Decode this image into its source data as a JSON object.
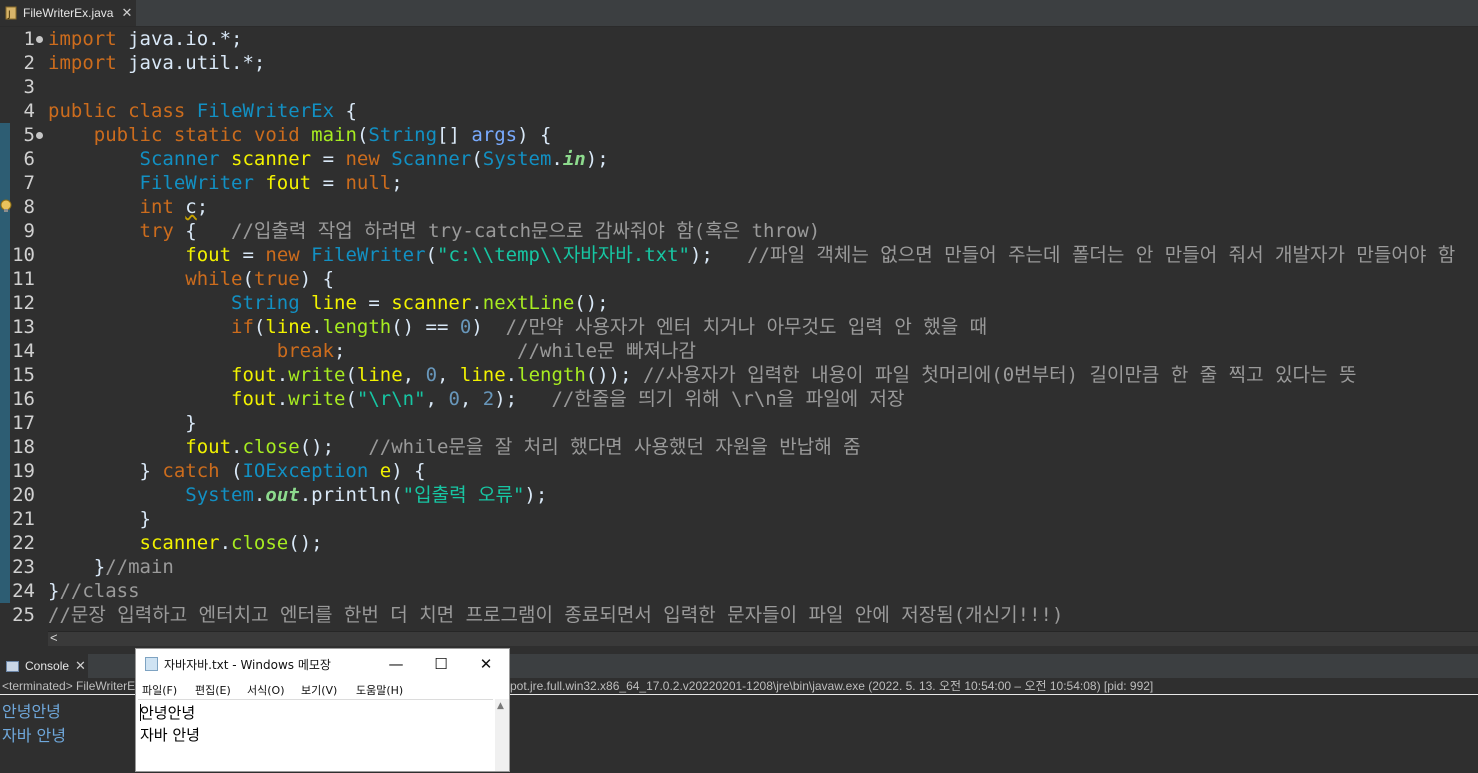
{
  "editor_tab": {
    "filename": "FileWriterEx.java",
    "close": "✕"
  },
  "code": {
    "lines": [
      {
        "num": "1",
        "fold": true,
        "segs": [
          [
            "kw",
            "import"
          ],
          [
            "pl",
            " java.io.*;"
          ]
        ]
      },
      {
        "num": "2",
        "segs": [
          [
            "kw",
            "import"
          ],
          [
            "pl",
            " java.util.*;"
          ]
        ]
      },
      {
        "num": "3",
        "segs": []
      },
      {
        "num": "4",
        "segs": [
          [
            "kw",
            "public"
          ],
          [
            "pl",
            " "
          ],
          [
            "kw",
            "class"
          ],
          [
            "pl",
            " "
          ],
          [
            "ty",
            "FileWriterEx"
          ],
          [
            "pl",
            " {"
          ]
        ]
      },
      {
        "num": "5",
        "fold": true,
        "segs": [
          [
            "pl",
            "    "
          ],
          [
            "kw",
            "public"
          ],
          [
            "pl",
            " "
          ],
          [
            "kw",
            "static"
          ],
          [
            "pl",
            " "
          ],
          [
            "kw",
            "void"
          ],
          [
            "pl",
            " "
          ],
          [
            "fn",
            "main"
          ],
          [
            "pl",
            "("
          ],
          [
            "ty",
            "String"
          ],
          [
            "pl",
            "[] "
          ],
          [
            "par",
            "args"
          ],
          [
            "pl",
            ") {"
          ]
        ]
      },
      {
        "num": "6",
        "segs": [
          [
            "pl",
            "        "
          ],
          [
            "ty",
            "Scanner"
          ],
          [
            "pl",
            " "
          ],
          [
            "var",
            "scanner"
          ],
          [
            "pl",
            " = "
          ],
          [
            "kw",
            "new"
          ],
          [
            "pl",
            " "
          ],
          [
            "ty",
            "Scanner"
          ],
          [
            "pl",
            "("
          ],
          [
            "ty",
            "System"
          ],
          [
            "pl",
            "."
          ],
          [
            "fld",
            "in"
          ],
          [
            "pl",
            ");"
          ]
        ]
      },
      {
        "num": "7",
        "segs": [
          [
            "pl",
            "        "
          ],
          [
            "ty",
            "FileWriter"
          ],
          [
            "pl",
            " "
          ],
          [
            "var",
            "fout"
          ],
          [
            "pl",
            " = "
          ],
          [
            "kw",
            "null"
          ],
          [
            "pl",
            ";"
          ]
        ]
      },
      {
        "num": "8",
        "segs": [
          [
            "pl",
            "        "
          ],
          [
            "kw",
            "int"
          ],
          [
            "pl",
            " "
          ],
          [
            "und",
            "c"
          ],
          [
            "pl",
            ";"
          ]
        ]
      },
      {
        "num": "9",
        "segs": [
          [
            "pl",
            "        "
          ],
          [
            "kw",
            "try"
          ],
          [
            "pl",
            " {   "
          ],
          [
            "cm",
            "//입출력 작업 하려면 try-catch문으로 감싸줘야 함(혹은 throw)"
          ]
        ]
      },
      {
        "num": "10",
        "segs": [
          [
            "pl",
            "            "
          ],
          [
            "var",
            "fout"
          ],
          [
            "pl",
            " = "
          ],
          [
            "kw",
            "new"
          ],
          [
            "pl",
            " "
          ],
          [
            "ty",
            "FileWriter"
          ],
          [
            "pl",
            "("
          ],
          [
            "str",
            "\"c:\\\\temp\\\\자바자바.txt\""
          ],
          [
            "pl",
            ");   "
          ],
          [
            "cm",
            "//파일 객체는 없으면 만들어 주는데 폴더는 안 만들어 줘서 개발자가 만들어야 함"
          ]
        ]
      },
      {
        "num": "11",
        "segs": [
          [
            "pl",
            "            "
          ],
          [
            "kw",
            "while"
          ],
          [
            "pl",
            "("
          ],
          [
            "kw",
            "true"
          ],
          [
            "pl",
            ") {"
          ]
        ]
      },
      {
        "num": "12",
        "segs": [
          [
            "pl",
            "                "
          ],
          [
            "ty",
            "String"
          ],
          [
            "pl",
            " "
          ],
          [
            "var",
            "line"
          ],
          [
            "pl",
            " = "
          ],
          [
            "var",
            "scanner"
          ],
          [
            "pl",
            "."
          ],
          [
            "fn",
            "nextLine"
          ],
          [
            "pl",
            "();"
          ]
        ]
      },
      {
        "num": "13",
        "segs": [
          [
            "pl",
            "                "
          ],
          [
            "kw",
            "if"
          ],
          [
            "pl",
            "("
          ],
          [
            "var",
            "line"
          ],
          [
            "pl",
            "."
          ],
          [
            "fn",
            "length"
          ],
          [
            "pl",
            "() == "
          ],
          [
            "num",
            "0"
          ],
          [
            "pl",
            ")  "
          ],
          [
            "cm",
            "//만약 사용자가 엔터 치거나 아무것도 입력 안 했을 때"
          ]
        ]
      },
      {
        "num": "14",
        "segs": [
          [
            "pl",
            "                    "
          ],
          [
            "kw",
            "break"
          ],
          [
            "pl",
            ";               "
          ],
          [
            "cm",
            "//while문 빠져나감"
          ]
        ]
      },
      {
        "num": "15",
        "segs": [
          [
            "pl",
            "                "
          ],
          [
            "var",
            "fout"
          ],
          [
            "pl",
            "."
          ],
          [
            "fn",
            "write"
          ],
          [
            "pl",
            "("
          ],
          [
            "var",
            "line"
          ],
          [
            "pl",
            ", "
          ],
          [
            "num",
            "0"
          ],
          [
            "pl",
            ", "
          ],
          [
            "var",
            "line"
          ],
          [
            "pl",
            "."
          ],
          [
            "fn",
            "length"
          ],
          [
            "pl",
            "()); "
          ],
          [
            "cm",
            "//사용자가 입력한 내용이 파일 첫머리에(0번부터) 길이만큼 한 줄 찍고 있다는 뜻"
          ]
        ]
      },
      {
        "num": "16",
        "segs": [
          [
            "pl",
            "                "
          ],
          [
            "var",
            "fout"
          ],
          [
            "pl",
            "."
          ],
          [
            "fn",
            "write"
          ],
          [
            "pl",
            "("
          ],
          [
            "str",
            "\"\\r\\n\""
          ],
          [
            "pl",
            ", "
          ],
          [
            "num",
            "0"
          ],
          [
            "pl",
            ", "
          ],
          [
            "num",
            "2"
          ],
          [
            "pl",
            ");   "
          ],
          [
            "cm",
            "//한줄을 띄기 위해 \\r\\n을 파일에 저장"
          ]
        ]
      },
      {
        "num": "17",
        "segs": [
          [
            "pl",
            "            }"
          ]
        ]
      },
      {
        "num": "18",
        "segs": [
          [
            "pl",
            "            "
          ],
          [
            "var",
            "fout"
          ],
          [
            "pl",
            "."
          ],
          [
            "fn",
            "close"
          ],
          [
            "pl",
            "();   "
          ],
          [
            "cm",
            "//while문을 잘 처리 했다면 사용했던 자원을 반납해 줌"
          ]
        ]
      },
      {
        "num": "19",
        "segs": [
          [
            "pl",
            "        } "
          ],
          [
            "kw",
            "catch"
          ],
          [
            "pl",
            " ("
          ],
          [
            "ty",
            "IOException"
          ],
          [
            "pl",
            " "
          ],
          [
            "var",
            "e"
          ],
          [
            "pl",
            ") {"
          ]
        ]
      },
      {
        "num": "20",
        "segs": [
          [
            "pl",
            "            "
          ],
          [
            "ty",
            "System"
          ],
          [
            "pl",
            "."
          ],
          [
            "fld",
            "out"
          ],
          [
            "pl",
            "."
          ],
          [
            "pl",
            "println("
          ],
          [
            "str",
            "\"입출력 오류\""
          ],
          [
            "pl",
            ");"
          ]
        ]
      },
      {
        "num": "21",
        "segs": [
          [
            "pl",
            "        }"
          ]
        ]
      },
      {
        "num": "22",
        "segs": [
          [
            "pl",
            "        "
          ],
          [
            "var",
            "scanner"
          ],
          [
            "pl",
            "."
          ],
          [
            "fn",
            "close"
          ],
          [
            "pl",
            "();"
          ]
        ]
      },
      {
        "num": "23",
        "segs": [
          [
            "pl",
            "    }"
          ],
          [
            "cm",
            "//main"
          ]
        ]
      },
      {
        "num": "24",
        "segs": [
          [
            "pl",
            "}"
          ],
          [
            "cm",
            "//class"
          ]
        ]
      },
      {
        "num": "25",
        "segs": [
          [
            "cm",
            "//문장 입력하고 엔터치고 엔터를 한번 더 치면 프로그램이 종료되면서 입력한 문자들이 파일 안에 저장됨(개신기!!!)"
          ]
        ]
      }
    ]
  },
  "hscroll": {
    "left_arrow": "<"
  },
  "console": {
    "tab_label": "Console",
    "close": "✕",
    "status_left": "<terminated> FileWriterEx",
    "status_right": "pot.jre.full.win32.x86_64_17.0.2.v20220201-1208\\jre\\bin\\javaw.exe  (2022. 5. 13. 오전 10:54:00 – 오전 10:54:08) [pid: 992]",
    "output": [
      "안녕안녕",
      "자바 안녕"
    ]
  },
  "notepad": {
    "title": "자바자바.txt - Windows 메모장",
    "minimize": "—",
    "maximize": "☐",
    "close": "✕",
    "menus": [
      "파일(F)",
      "편집(E)",
      "서식(O)",
      "보기(V)",
      "도움말(H)"
    ],
    "content": [
      "안녕안녕",
      "자바 안녕"
    ],
    "scroll_up": "▲"
  },
  "colors": {
    "editor_bg": "#2f2f2f",
    "keyword": "#cc6c1d",
    "type": "#1290c3",
    "variable": "#f2f200",
    "method": "#a7ec21",
    "string": "#17c6a3",
    "comment": "#9a9a9a",
    "console_text": "#6fa8dc"
  }
}
